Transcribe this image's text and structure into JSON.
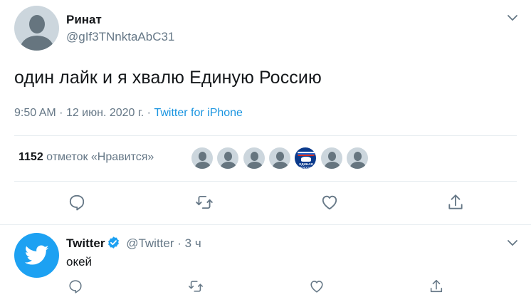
{
  "tweet": {
    "author_name": "Ринат",
    "author_handle": "@gIf3TNnktaAbC31",
    "text": "один лайк и я хвалю Единую Россию",
    "time": "9:50 AM",
    "sep1": "·",
    "date": "12 июн. 2020 г.",
    "sep2": "·",
    "source": "Twitter for iPhone",
    "likes_count": "1152",
    "likes_label": "отметок «Нравится»",
    "liker_badge_text": "ЕДИНАЯ РОССИЯ"
  },
  "reply": {
    "author_name": "Twitter",
    "author_handle": "@Twitter",
    "dot": "·",
    "time": "3 ч",
    "text": "окей"
  },
  "colors": {
    "primary_text": "#14171a",
    "secondary_text": "#657786",
    "link": "#1b95e0",
    "twitter_blue": "#1da1f2",
    "divider": "#e6ecf0"
  },
  "icons": {
    "menu": "chevron-down-icon",
    "reply": "comment-icon",
    "retweet": "retweet-icon",
    "like": "heart-icon",
    "share": "share-icon",
    "verified": "verified-badge-icon"
  }
}
